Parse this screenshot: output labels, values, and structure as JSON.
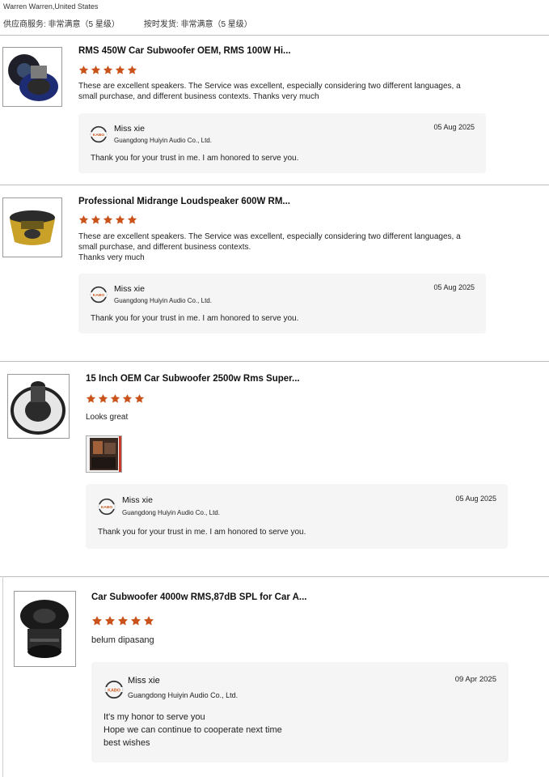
{
  "header": {
    "buyer": "Warren Warren,United States",
    "supplier_service": "供应商服务: 非常满意（5 星级）",
    "on_time_shipping": "按时发货: 非常满意（5 星级）"
  },
  "accent_star_color": "#c9531a",
  "reviews": [
    {
      "product_title": "RMS 450W Car Subwoofer OEM, RMS 100W Hi...",
      "rating": 5,
      "text_lines": [
        "These are excellent speakers. The Service was excellent, especially considering two different languages, a",
        "small purchase, and different business contexts. Thanks very much"
      ],
      "reply": {
        "name": "Miss xie",
        "company": "Guangdong Huiyin Audio Co., Ltd.",
        "date": "05 Aug 2025",
        "message_lines": [
          "Thank you for your trust in me. I am honored to serve you."
        ]
      }
    },
    {
      "product_title": "Professional Midrange Loudspeaker 600W RM...",
      "rating": 5,
      "text_lines": [
        "These are excellent speakers. The Service was excellent, especially considering two different languages, a",
        "small purchase, and different business contexts.",
        "Thanks very much"
      ],
      "reply": {
        "name": "Miss xie",
        "company": "Guangdong Huiyin Audio Co., Ltd.",
        "date": "05 Aug 2025",
        "message_lines": [
          "Thank you for your trust in me. I am honored to serve you."
        ]
      }
    },
    {
      "product_title": "15 Inch OEM Car Subwoofer 2500w Rms Super...",
      "rating": 5,
      "text_lines": [
        "Looks great"
      ],
      "reply": {
        "name": "Miss xie",
        "company": "Guangdong Huiyin Audio Co., Ltd.",
        "date": "05 Aug 2025",
        "message_lines": [
          "Thank you for your trust in me. I am honored to serve you."
        ]
      }
    },
    {
      "product_title": "Car Subwoofer 4000w RMS,87dB SPL for Car A...",
      "rating": 5,
      "text_lines": [
        "belum dipasang"
      ],
      "reply": {
        "name": "Miss xie",
        "company": "Guangdong Huiyin Audio Co., Ltd.",
        "date": "09 Apr 2025",
        "message_lines": [
          "It's my honor to serve you",
          "Hope we can continue to cooperate next time",
          "best wishes"
        ]
      }
    }
  ]
}
